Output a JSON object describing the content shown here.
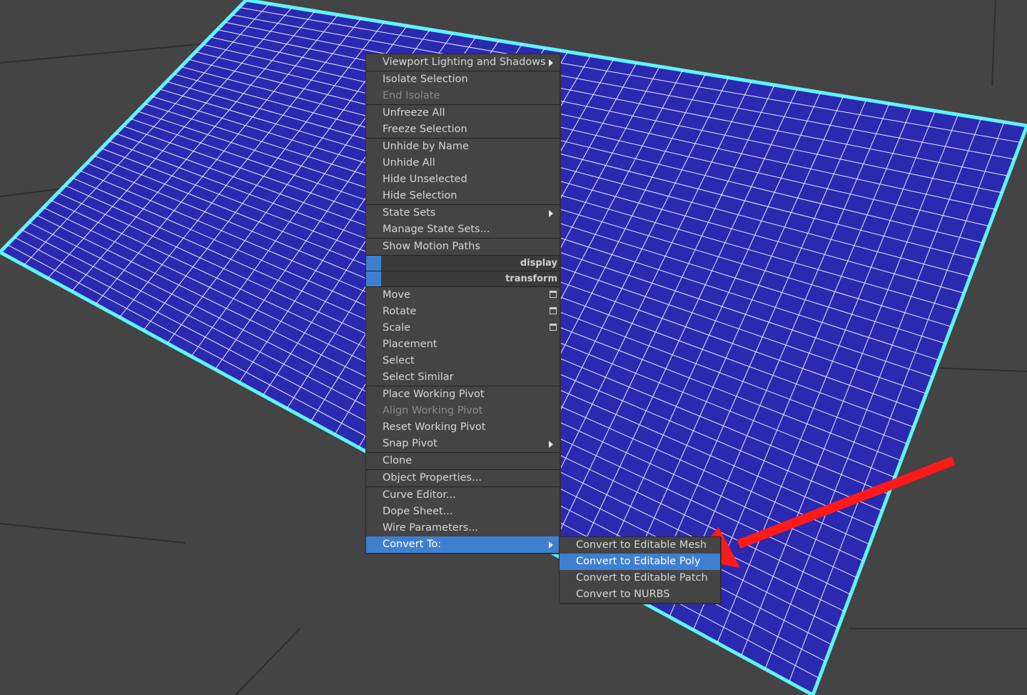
{
  "colors": {
    "background": "#444444",
    "plane": "#2b29b0",
    "plane_edge": "#5ff3ff",
    "grid_line": "#ffffff",
    "menu_bg": "#444444",
    "highlight": "#3f7fd0",
    "annotation_arrow": "#ff1a1a"
  },
  "quad_menu": {
    "items": [
      {
        "label": "Viewport Lighting and Shadows",
        "submenu": true
      },
      {
        "label": "Isolate Selection"
      },
      {
        "label": "End Isolate",
        "disabled": true
      },
      {
        "label": "Unfreeze All"
      },
      {
        "label": "Freeze Selection"
      },
      {
        "label": "Unhide by Name"
      },
      {
        "label": "Unhide All"
      },
      {
        "label": "Hide Unselected"
      },
      {
        "label": "Hide Selection"
      },
      {
        "label": "State Sets",
        "submenu": true
      },
      {
        "label": "Manage State Sets..."
      },
      {
        "label": "Show Motion Paths"
      },
      {
        "label": "display"
      },
      {
        "label": "transform"
      },
      {
        "label": "Move",
        "options_icon": "settings-box-icon"
      },
      {
        "label": "Rotate",
        "options_icon": "settings-box-icon"
      },
      {
        "label": "Scale",
        "options_icon": "settings-box-icon"
      },
      {
        "label": "Placement"
      },
      {
        "label": "Select"
      },
      {
        "label": "Select Similar"
      },
      {
        "label": "Place Working Pivot"
      },
      {
        "label": "Align Working Pivot",
        "disabled": true
      },
      {
        "label": "Reset Working Pivot"
      },
      {
        "label": "Snap Pivot",
        "submenu": true
      },
      {
        "label": "Clone"
      },
      {
        "label": "Object Properties..."
      },
      {
        "label": "Curve Editor..."
      },
      {
        "label": "Dope Sheet..."
      },
      {
        "label": "Wire Parameters..."
      },
      {
        "label": "Convert To:",
        "submenu": true,
        "active": true
      }
    ]
  },
  "convert_submenu": {
    "items": [
      {
        "label": "Convert to Editable Mesh"
      },
      {
        "label": "Convert to Editable Poly",
        "active": true
      },
      {
        "label": "Convert to Editable Patch"
      },
      {
        "label": "Convert to NURBS"
      }
    ]
  }
}
